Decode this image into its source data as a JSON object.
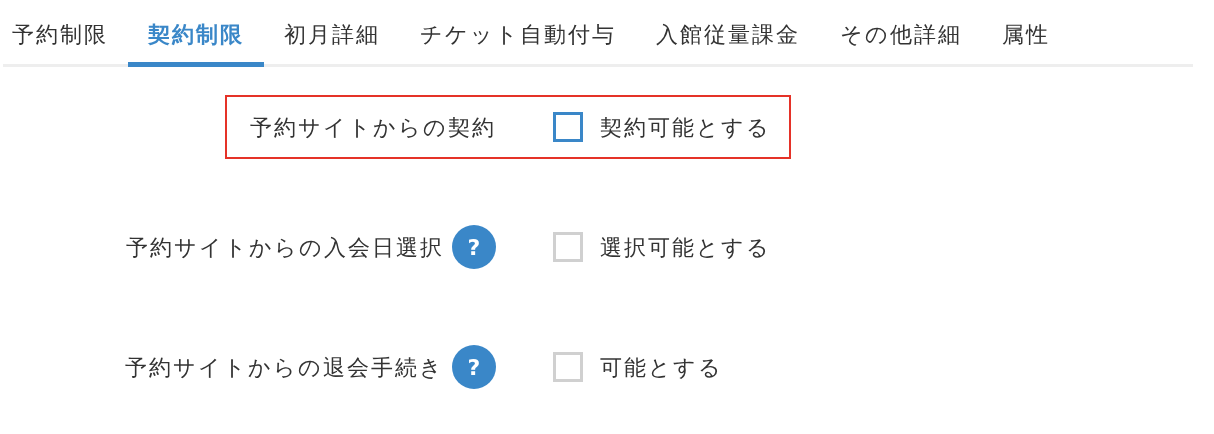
{
  "tabs": [
    {
      "label": "予約制限",
      "selected": false
    },
    {
      "label": "契約制限",
      "selected": true
    },
    {
      "label": "初月詳細",
      "selected": false
    },
    {
      "label": "チケット自動付与",
      "selected": false
    },
    {
      "label": "入館従量課金",
      "selected": false
    },
    {
      "label": "その他詳細",
      "selected": false
    },
    {
      "label": "属性",
      "selected": false
    }
  ],
  "settings": [
    {
      "label": "予約サイトからの契約",
      "highlighted": true,
      "checkbox": {
        "label": "契約可能とする",
        "checked": false
      }
    },
    {
      "label": "予約サイトからの入会日選択",
      "help": "?",
      "highlighted": false,
      "checkbox": {
        "label": "選択可能とする",
        "checked": false
      }
    },
    {
      "label": "予約サイトからの退会手続き",
      "help": "?",
      "highlighted": false,
      "checkbox": {
        "label": "可能とする",
        "checked": false
      }
    }
  ]
}
